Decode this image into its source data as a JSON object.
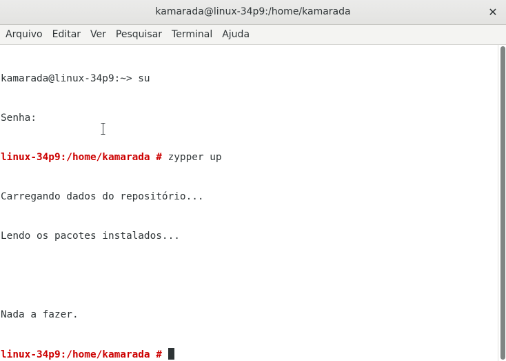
{
  "window": {
    "title": "kamarada@linux-34p9:/home/kamarada",
    "close_label": "✕"
  },
  "menubar": {
    "items": [
      "Arquivo",
      "Editar",
      "Ver",
      "Pesquisar",
      "Terminal",
      "Ajuda"
    ]
  },
  "terminal": {
    "lines": [
      {
        "prompt": "",
        "text": "kamarada@linux-34p9:~> su"
      },
      {
        "prompt": "",
        "text": "Senha:"
      },
      {
        "prompt": "linux-34p9:/home/kamarada # ",
        "text": "zypper up"
      },
      {
        "prompt": "",
        "text": "Carregando dados do repositório..."
      },
      {
        "prompt": "",
        "text": "Lendo os pacotes instalados..."
      },
      {
        "prompt": "",
        "text": ""
      },
      {
        "prompt": "",
        "text": "Nada a fazer."
      },
      {
        "prompt": "linux-34p9:/home/kamarada # ",
        "text": ""
      }
    ]
  },
  "colors": {
    "root_prompt": "#cc0000",
    "text": "#2e3436",
    "background": "#ffffff"
  }
}
